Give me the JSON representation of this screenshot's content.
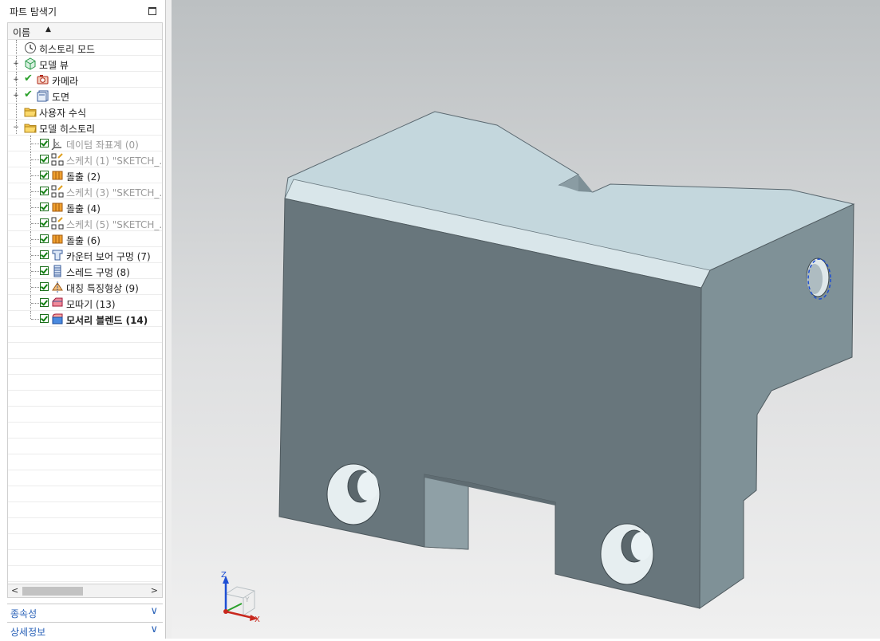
{
  "panel": {
    "title": "파트 탐색기",
    "column_header": "이름",
    "sort_indicator": "▲"
  },
  "tree": [
    {
      "label": "히스토리 모드",
      "icon": "clock-icon",
      "level": 0,
      "expander": "",
      "checkbox": "none",
      "style": "normal"
    },
    {
      "label": "모델 뷰",
      "icon": "model-view-cube-icon",
      "level": 0,
      "expander": "+",
      "checkbox": "none",
      "style": "normal"
    },
    {
      "label": "카메라",
      "icon": "camera-icon",
      "level": 0,
      "expander": "+",
      "checkbox": "greencheck",
      "style": "normal"
    },
    {
      "label": "도면",
      "icon": "drawing-sheet-icon",
      "level": 0,
      "expander": "+",
      "checkbox": "greencheck",
      "style": "normal"
    },
    {
      "label": "사용자 수식",
      "icon": "folder-icon",
      "level": 0,
      "expander": "",
      "checkbox": "none",
      "style": "normal"
    },
    {
      "label": "모델 히스토리",
      "icon": "folder-icon",
      "level": 0,
      "expander": "−",
      "checkbox": "none",
      "style": "normal"
    },
    {
      "label": "데이텀 좌표계 (0)",
      "icon": "datum-csys-icon",
      "level": 1,
      "checkbox": "box",
      "style": "dim"
    },
    {
      "label": "스케치 (1) \"SKETCH_...",
      "icon": "sketch-icon",
      "level": 1,
      "checkbox": "box",
      "style": "dim"
    },
    {
      "label": "돌출 (2)",
      "icon": "extrude-icon",
      "level": 1,
      "checkbox": "box",
      "style": "normal"
    },
    {
      "label": "스케치 (3) \"SKETCH_...",
      "icon": "sketch-icon",
      "level": 1,
      "checkbox": "box",
      "style": "dim"
    },
    {
      "label": "돌출 (4)",
      "icon": "extrude-icon",
      "level": 1,
      "checkbox": "box",
      "style": "normal"
    },
    {
      "label": "스케치 (5) \"SKETCH_...",
      "icon": "sketch-icon",
      "level": 1,
      "checkbox": "box",
      "style": "dim"
    },
    {
      "label": "돌출 (6)",
      "icon": "extrude-icon",
      "level": 1,
      "checkbox": "box",
      "style": "normal"
    },
    {
      "label": "카운터 보어 구멍 (7)",
      "icon": "counterbore-hole-icon",
      "level": 1,
      "checkbox": "box",
      "style": "normal"
    },
    {
      "label": "스레드 구멍 (8)",
      "icon": "threaded-hole-icon",
      "level": 1,
      "checkbox": "box",
      "style": "normal"
    },
    {
      "label": "대칭 특징형상 (9)",
      "icon": "mirror-feature-icon",
      "level": 1,
      "checkbox": "box",
      "style": "normal"
    },
    {
      "label": "모따기 (13)",
      "icon": "chamfer-icon",
      "level": 1,
      "checkbox": "box",
      "style": "normal"
    },
    {
      "label": "모서리 블렌드 (14)",
      "icon": "edge-blend-icon",
      "level": 1,
      "checkbox": "box",
      "style": "bold"
    }
  ],
  "sections": [
    {
      "label": "종속성",
      "icon": "chevron-down-icon"
    },
    {
      "label": "상세정보",
      "icon": "chevron-down-icon"
    }
  ],
  "triad": {
    "x_label": "X",
    "y_label": "Y",
    "z_label": "Z"
  },
  "colors": {
    "face_top": "#c3d6dc",
    "face_front": "#68767c",
    "face_side": "#7e9097",
    "accent_blue": "#2a62b8"
  }
}
